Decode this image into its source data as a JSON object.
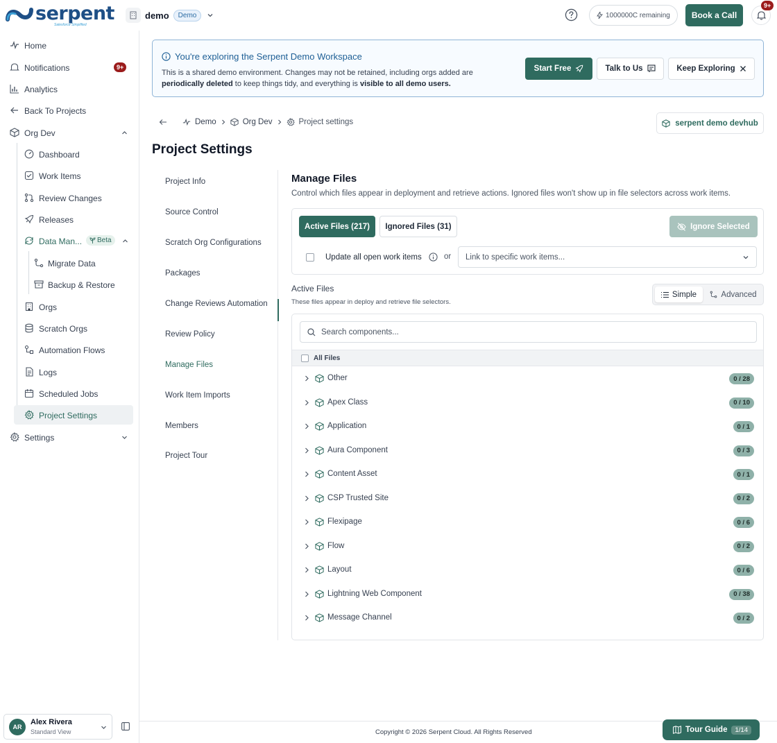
{
  "brand": {
    "name": "serpent",
    "tagline": "Salesforce Simplified",
    "colors": {
      "accent": "#2f6b5f",
      "brand": "#1e4f86",
      "danger": "#9b1c1c"
    }
  },
  "workspace": {
    "name": "demo",
    "badge": "Demo"
  },
  "header": {
    "credits": "1000000C remaining",
    "book_call": "Book a Call",
    "notif_badge": "9+"
  },
  "sidebar": {
    "home": "Home",
    "notifications": "Notifications",
    "notif_badge": "9+",
    "analytics": "Analytics",
    "back": "Back To Projects",
    "org": "Org Dev",
    "dashboard": "Dashboard",
    "work_items": "Work Items",
    "review_changes": "Review Changes",
    "releases": "Releases",
    "data_man": "Data Man...",
    "beta": "Beta",
    "migrate": "Migrate Data",
    "backup": "Backup & Restore",
    "orgs": "Orgs",
    "scratch": "Scratch Orgs",
    "automation": "Automation Flows",
    "logs": "Logs",
    "scheduled": "Scheduled Jobs",
    "project_settings": "Project Settings",
    "settings": "Settings"
  },
  "user": {
    "initials": "AR",
    "name": "Alex Rivera",
    "view": "Standard View"
  },
  "banner": {
    "title": "You're exploring the Serpent Demo Workspace",
    "text1": "This is a shared demo environment. Changes may not be retained, including orgs added are ",
    "bold1": "periodically deleted",
    "text2": " to keep things tidy, and everything is ",
    "bold2": "visible to all demo users.",
    "start_free": "Start Free",
    "talk": "Talk to Us",
    "keep": "Keep Exploring"
  },
  "breadcrumb": {
    "demo": "Demo",
    "org": "Org Dev",
    "current": "Project settings"
  },
  "devhub": "serpent demo devhub",
  "page_title": "Project Settings",
  "subnav": [
    "Project Info",
    "Source Control",
    "Scratch Org Configurations",
    "Packages",
    "Change Reviews Automation",
    "Review Policy",
    "Manage Files",
    "Work Item Imports",
    "Members",
    "Project Tour"
  ],
  "manage": {
    "title": "Manage Files",
    "desc": "Control which files appear in deployment and retrieve actions. Ignored files won't show up in file selectors across work items.",
    "tab_active": "Active Files (217)",
    "tab_ignored": "Ignored Files (31)",
    "ignore_selected": "Ignore Selected",
    "update_all": "Update all open work items",
    "or": "or",
    "link_placeholder": "Link to specific work items...",
    "active_title": "Active Files",
    "active_desc": "These files appear in deploy and retrieve file selectors.",
    "simple": "Simple",
    "advanced": "Advanced",
    "search_placeholder": "Search components...",
    "all_files": "All Files",
    "rows": [
      {
        "name": "Other",
        "count": "0 / 28"
      },
      {
        "name": "Apex Class",
        "count": "0 / 10"
      },
      {
        "name": "Application",
        "count": "0 / 1"
      },
      {
        "name": "Aura Component",
        "count": "0 / 3"
      },
      {
        "name": "Content Asset",
        "count": "0 / 1"
      },
      {
        "name": "CSP Trusted Site",
        "count": "0 / 2"
      },
      {
        "name": "Flexipage",
        "count": "0 / 6"
      },
      {
        "name": "Flow",
        "count": "0 / 2"
      },
      {
        "name": "Layout",
        "count": "0 / 6"
      },
      {
        "name": "Lightning Web Component",
        "count": "0 / 38"
      },
      {
        "name": "Message Channel",
        "count": "0 / 2"
      }
    ]
  },
  "footer": {
    "copyright": "Copyright © 2026 Serpent Cloud. All Rights Reserved"
  },
  "tour": {
    "label": "Tour Guide",
    "page": "1/14"
  }
}
